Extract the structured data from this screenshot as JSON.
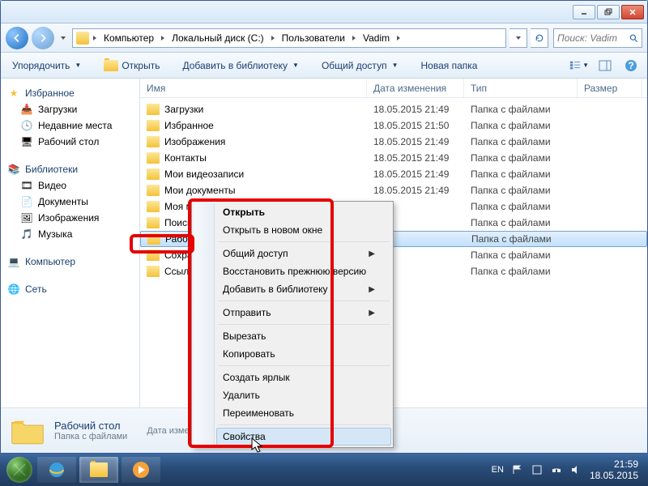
{
  "titlebar": {},
  "nav": {
    "breadcrumbs": [
      "Компьютер",
      "Локальный диск (C:)",
      "Пользователи",
      "Vadim"
    ],
    "search_placeholder": "Поиск: Vadim"
  },
  "toolbar": {
    "organize": "Упорядочить",
    "open": "Открыть",
    "add_to_library": "Добавить в библиотеку",
    "share": "Общий доступ",
    "new_folder": "Новая папка"
  },
  "sidebar": {
    "favorites": {
      "label": "Избранное",
      "items": [
        "Загрузки",
        "Недавние места",
        "Рабочий стол"
      ]
    },
    "libraries": {
      "label": "Библиотеки",
      "items": [
        "Видео",
        "Документы",
        "Изображения",
        "Музыка"
      ]
    },
    "computer": {
      "label": "Компьютер"
    },
    "network": {
      "label": "Сеть"
    }
  },
  "columns": {
    "name": "Имя",
    "date": "Дата изменения",
    "type": "Тип",
    "size": "Размер"
  },
  "rows": [
    {
      "name": "Загрузки",
      "date": "18.05.2015 21:49",
      "type": "Папка с файлами"
    },
    {
      "name": "Избранное",
      "date": "18.05.2015 21:50",
      "type": "Папка с файлами"
    },
    {
      "name": "Изображения",
      "date": "18.05.2015 21:49",
      "type": "Папка с файлами"
    },
    {
      "name": "Контакты",
      "date": "18.05.2015 21:49",
      "type": "Папка с файлами"
    },
    {
      "name": "Мои видеозаписи",
      "date": "18.05.2015 21:49",
      "type": "Папка с файлами"
    },
    {
      "name": "Мои документы",
      "date": "18.05.2015 21:49",
      "type": "Папка с файлами"
    },
    {
      "name": "Моя музыка",
      "date_partial": ":49",
      "type": "Папка с файлами"
    },
    {
      "name": "Поиски",
      "date_partial": ":49",
      "type": "Папка с файлами"
    },
    {
      "name": "Рабочий стол",
      "date_partial": ":49",
      "type": "Папка с файлами",
      "selected": true
    },
    {
      "name": "Сохраненные игры",
      "date_partial": ":49",
      "type": "Папка с файлами"
    },
    {
      "name": "Ссылки",
      "date_partial": ":49",
      "type": "Папка с файлами"
    }
  ],
  "context_menu": {
    "open": "Открыть",
    "open_new": "Открыть в новом окне",
    "share": "Общий доступ",
    "restore": "Восстановить прежнюю версию",
    "add_lib": "Добавить в библиотеку",
    "send_to": "Отправить",
    "cut": "Вырезать",
    "copy": "Копировать",
    "shortcut": "Создать ярлык",
    "delete": "Удалить",
    "rename": "Переименовать",
    "properties": "Свойства"
  },
  "details": {
    "title": "Рабочий стол",
    "type": "Папка с файлами",
    "date_label": "Дата изменения:"
  },
  "tray": {
    "lang": "EN",
    "time": "21:59",
    "date": "18.05.2015"
  }
}
